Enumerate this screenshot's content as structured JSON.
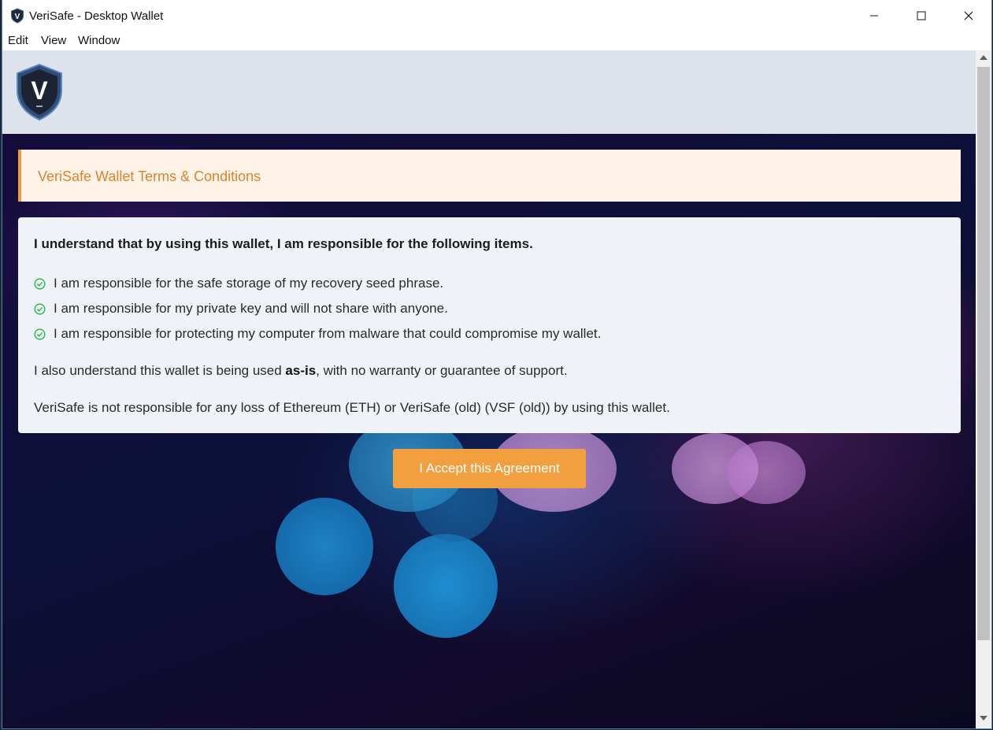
{
  "window": {
    "title": "VeriSafe - Desktop Wallet",
    "icon": "verisafe-shield-icon",
    "controls": [
      "minimize-icon",
      "maximize-icon",
      "close-icon"
    ]
  },
  "menu": {
    "edit": "Edit",
    "view": "View",
    "window": "Window"
  },
  "header": {
    "logo_letter": "V"
  },
  "terms": {
    "title": "VeriSafe Wallet Terms & Conditions",
    "heading": "I understand that by using this wallet, I am responsible for the following items.",
    "items": [
      "I am responsible for the safe storage of my recovery seed phrase.",
      "I am responsible for my private key and will not share with anyone.",
      "I am responsible for protecting my computer from malware that could compromise my wallet."
    ],
    "asis_prefix": "I also understand this wallet is being used ",
    "asis_bold": "as-is",
    "asis_suffix": ", with no warranty or guarantee of support.",
    "disclaimer": "VeriSafe is not responsible for any loss of Ethereum (ETH) or VeriSafe (old) (VSF (old)) by using this wallet."
  },
  "accept_button": "I Accept this Agreement",
  "colors": {
    "accent": "#f2a03f",
    "banner_bg": "#fff3e8",
    "banner_text": "#d88530",
    "check": "#2db84d",
    "header_bg": "#dee2ea",
    "card_bg": "#eff2f7"
  }
}
